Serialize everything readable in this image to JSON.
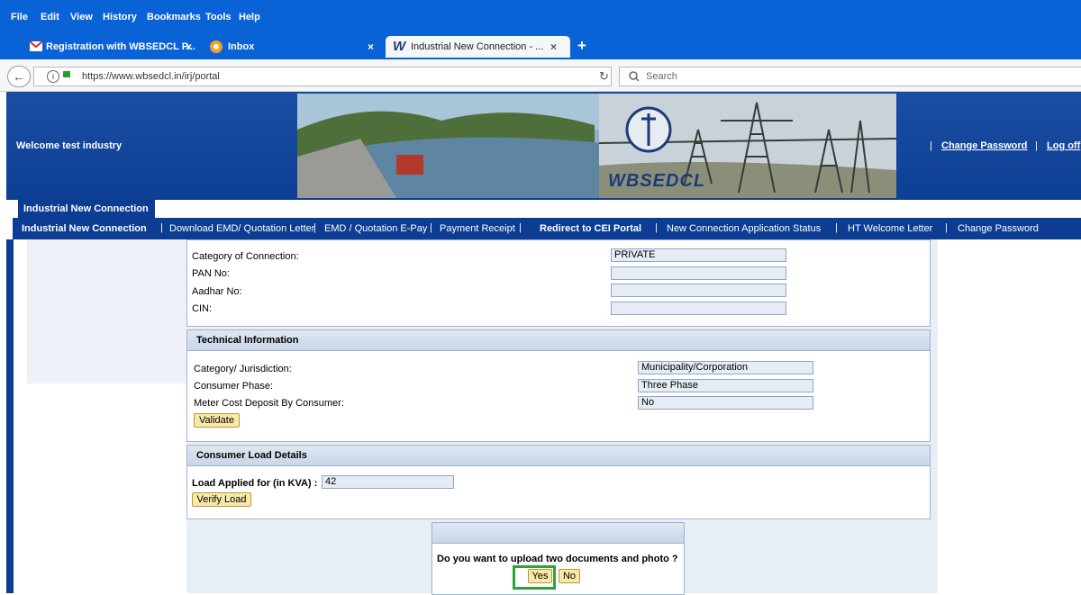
{
  "browser": {
    "menu": [
      "File",
      "Edit",
      "View",
      "History",
      "Bookmarks",
      "Tools",
      "Help"
    ],
    "tabs": [
      {
        "label": "Registration with WBSEDCL P...",
        "close": "×"
      },
      {
        "label": "Inbox",
        "close": "×"
      },
      {
        "label": "Industrial New Connection - ...",
        "close": "×"
      }
    ],
    "new_tab": "+",
    "url": "https://www.wbsedcl.in/irj/portal",
    "search_placeholder": "Search"
  },
  "header": {
    "welcome": "Welcome test industry",
    "logo_text": "WBSEDCL",
    "links": [
      "Change Password",
      "Log off"
    ]
  },
  "page_tab": "Industrial New Connection",
  "subnav": [
    "Industrial New Connection",
    "Download EMD/ Quotation Letter",
    "EMD / Quotation E-Pay",
    "Payment Receipt",
    "Redirect to CEI Portal",
    "New Connection Application Status",
    "HT Welcome Letter",
    "Change Password"
  ],
  "general": {
    "rows": [
      {
        "label": "Category of Connection:",
        "value": "PRIVATE"
      },
      {
        "label": "PAN No:",
        "value": ""
      },
      {
        "label": "Aadhar No:",
        "value": ""
      },
      {
        "label": "CIN:",
        "value": ""
      }
    ]
  },
  "technical": {
    "title": "Technical Information",
    "rows": [
      {
        "label": "Category/ Jurisdiction:",
        "value": "Municipality/Corporation"
      },
      {
        "label": "Consumer Phase:",
        "value": "Three Phase"
      },
      {
        "label": "Meter Cost Deposit By Consumer:",
        "value": "No"
      }
    ],
    "validate": "Validate"
  },
  "load": {
    "title": "Consumer Load Details",
    "label": "Load Applied for (in KVA) :",
    "value": "42",
    "verify": "Verify Load"
  },
  "dialog": {
    "question": "Do you want to upload two documents and photo ?",
    "yes": "Yes",
    "no": "No"
  },
  "colors": {
    "chrome": "#0a63d6",
    "portal_blue": "#0c3d92",
    "highlight": "#2fa13a",
    "button": "#f8e9a9"
  }
}
